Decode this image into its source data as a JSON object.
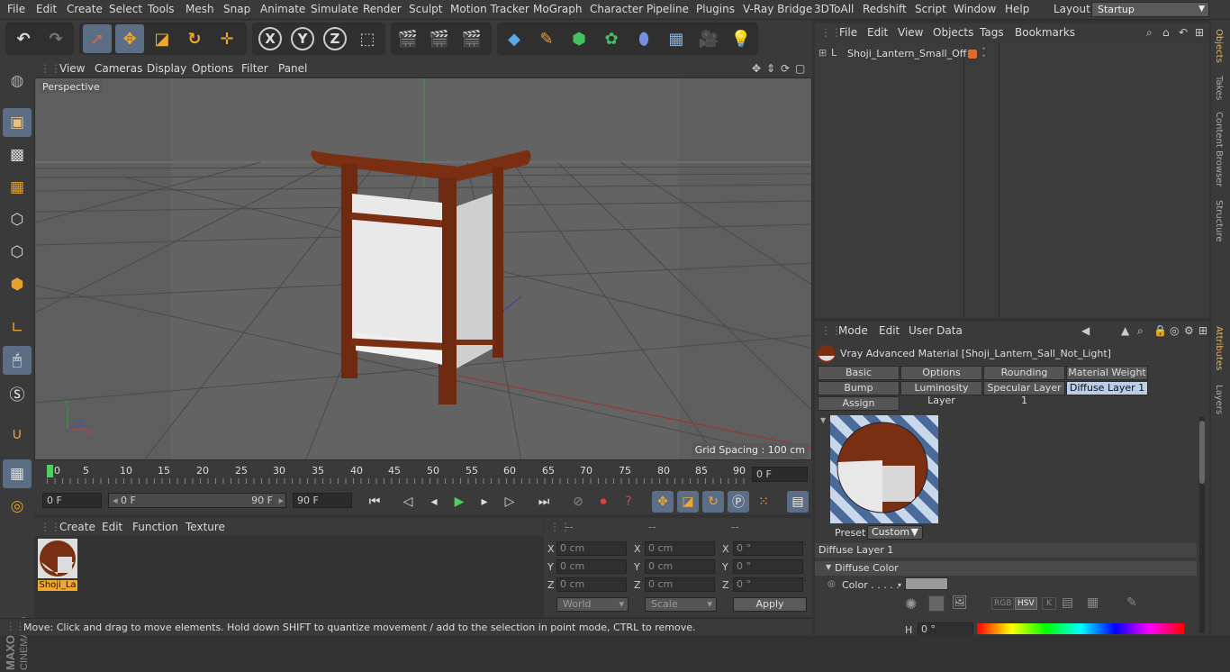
{
  "menubar": {
    "items": [
      "File",
      "Edit",
      "Create",
      "Select",
      "Tools",
      "Mesh",
      "Snap",
      "Animate",
      "Simulate",
      "Render",
      "Sculpt",
      "Motion Tracker",
      "MoGraph",
      "Character",
      "Pipeline",
      "Plugins",
      "V-Ray Bridge",
      "3DToAll",
      "Redshift",
      "Script",
      "Window",
      "Help"
    ],
    "layout_label": "Layout:",
    "layout_value": "Startup"
  },
  "toolbar": {
    "axis_x": "X",
    "axis_y": "Y",
    "axis_z": "Z"
  },
  "viewport": {
    "menu": [
      "View",
      "Cameras",
      "Display",
      "Options",
      "Filter",
      "Panel"
    ],
    "camera_label": "Perspective",
    "grid_spacing": "Grid Spacing : 100 cm"
  },
  "timeline": {
    "ticks": [
      "0",
      "5",
      "10",
      "15",
      "20",
      "25",
      "30",
      "35",
      "40",
      "45",
      "50",
      "55",
      "60",
      "65",
      "70",
      "75",
      "80",
      "85",
      "90"
    ],
    "current_frame": "0 F"
  },
  "playbar": {
    "start": "0 F",
    "range_start": "0 F",
    "range_end": "90 F",
    "end": "90 F"
  },
  "material_manager": {
    "menu": [
      "Create",
      "Edit",
      "Function",
      "Texture"
    ],
    "material_name": "Shoji_La"
  },
  "coordinates": {
    "headers": [
      "--",
      "--",
      "--"
    ],
    "rows": [
      {
        "label": "X",
        "pos": "0 cm",
        "label2": "X",
        "size": "0 cm",
        "label3": "X",
        "rot": "0 °"
      },
      {
        "label": "Y",
        "pos": "0 cm",
        "label2": "Y",
        "size": "0 cm",
        "label3": "Y",
        "rot": "0 °"
      },
      {
        "label": "Z",
        "pos": "0 cm",
        "label2": "Z",
        "size": "0 cm",
        "label3": "Z",
        "rot": "0 °"
      }
    ],
    "world": "World",
    "scale": "Scale",
    "apply": "Apply"
  },
  "status_bar": {
    "text": "Move: Click and drag to move elements. Hold down SHIFT to quantize movement / add to the selection in point mode, CTRL to remove."
  },
  "object_manager": {
    "menu": [
      "File",
      "Edit",
      "View",
      "Objects",
      "Tags",
      "Bookmarks"
    ],
    "object_name": "Shoji_Lantern_Small_Off"
  },
  "attribute_manager": {
    "menu": [
      "Mode",
      "Edit",
      "User Data"
    ],
    "material_title": "Vray Advanced Material [Shoji_Lantern_Sall_Not_Light]",
    "tabs_row1": [
      "Basic",
      "Options",
      "Rounding",
      "Material Weight"
    ],
    "tabs_row2": [
      "Bump",
      "Luminosity Layer",
      "Specular Layer 1",
      "Diffuse Layer 1"
    ],
    "tabs_row3": [
      "Assign"
    ],
    "preset_label": "Preset",
    "preset_value": "Custom",
    "section_title": "Diffuse Layer 1",
    "group_title": "Diffuse Color",
    "color_label": "Color . . . . .",
    "h_label": "H",
    "h_value": "0 °",
    "mode_buttons": [
      "RGB",
      "HSV",
      "K"
    ]
  },
  "right_tabs": [
    "Objects",
    "Takes",
    "Content Browser",
    "Structure",
    "Attributes",
    "Layers"
  ],
  "colors": {
    "accent_selected": "#5b6e85",
    "tab_active": "#b9cde6",
    "wood": "#7a2f12",
    "grid_green_axis": "#3c9a3c",
    "grid_red_axis": "#a03030"
  }
}
